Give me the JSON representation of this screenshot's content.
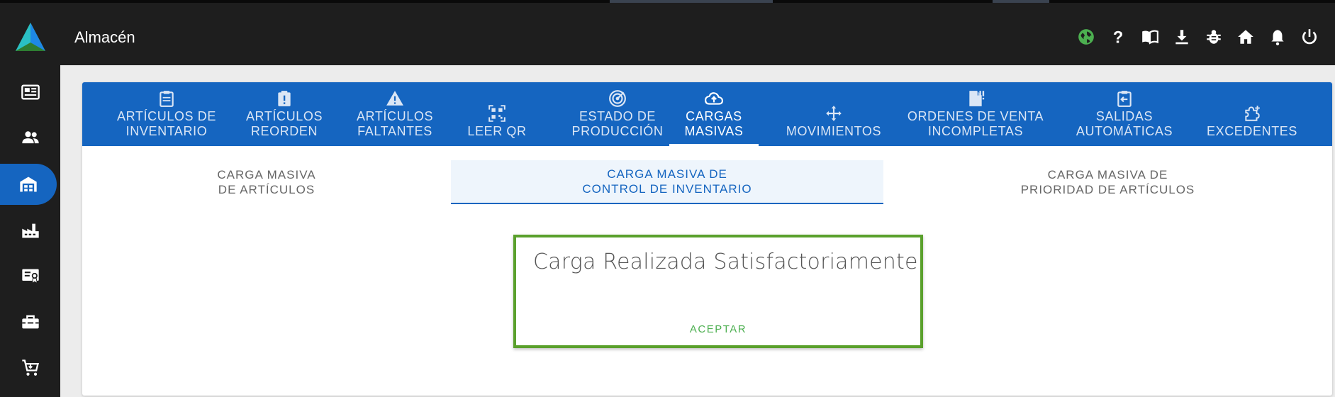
{
  "app": {
    "title": "Almacén"
  },
  "top_icons": [
    {
      "name": "globe-icon",
      "color": "#4caf50"
    },
    {
      "name": "help-icon"
    },
    {
      "name": "book-icon"
    },
    {
      "name": "download-icon"
    },
    {
      "name": "bug-icon"
    },
    {
      "name": "home-icon"
    },
    {
      "name": "bell-icon"
    },
    {
      "name": "power-icon"
    }
  ],
  "sidebar": {
    "items": [
      {
        "icon": "newspaper-icon"
      },
      {
        "icon": "people-icon"
      },
      {
        "icon": "warehouse-icon",
        "active": true
      },
      {
        "icon": "factory-icon"
      },
      {
        "icon": "certificate-icon"
      },
      {
        "icon": "toolbox-icon"
      },
      {
        "icon": "cart-icon"
      }
    ]
  },
  "tabs": [
    {
      "label": "ARTÍCULOS DE\nINVENTARIO",
      "icon": "clipboard-icon"
    },
    {
      "label": "ARTÍCULOS\nREORDEN",
      "icon": "clipboard-alert-icon"
    },
    {
      "label": "ARTÍCULOS\nFALTANTES",
      "icon": "warning-icon"
    },
    {
      "label": "LEER QR",
      "icon": "qr-icon"
    },
    {
      "label": "ESTADO DE\nPRODUCCIÓN",
      "icon": "radar-icon"
    },
    {
      "label": "CARGAS\nMASIVAS",
      "icon": "cloud-upload-icon",
      "active": true
    },
    {
      "label": "MOVIMIENTOS",
      "icon": "move-icon"
    },
    {
      "label": "ORDENES DE VENTA\nINCOMPLETAS",
      "icon": "file-alert-icon"
    },
    {
      "label": "SALIDAS\nAUTOMÁTICAS",
      "icon": "clipboard-exit-icon"
    },
    {
      "label": "EXCEDENTES",
      "icon": "puzzle-plus-icon"
    }
  ],
  "subtabs": [
    {
      "label": "CARGA MASIVA\nDE ARTÍCULOS"
    },
    {
      "label": "CARGA MASIVA DE\nCONTROL DE INVENTARIO",
      "active": true
    },
    {
      "label": "CARGA MASIVA DE\nPRIORIDAD DE ARTÍCULOS"
    }
  ],
  "dialog": {
    "message": "Carga Realizada Satisfactoriamente",
    "button": "ACEPTAR"
  },
  "colors": {
    "primary": "#1565c0",
    "topbar": "#1e1e1e",
    "success_border": "#5aa02c",
    "success_text": "#4caf50"
  }
}
